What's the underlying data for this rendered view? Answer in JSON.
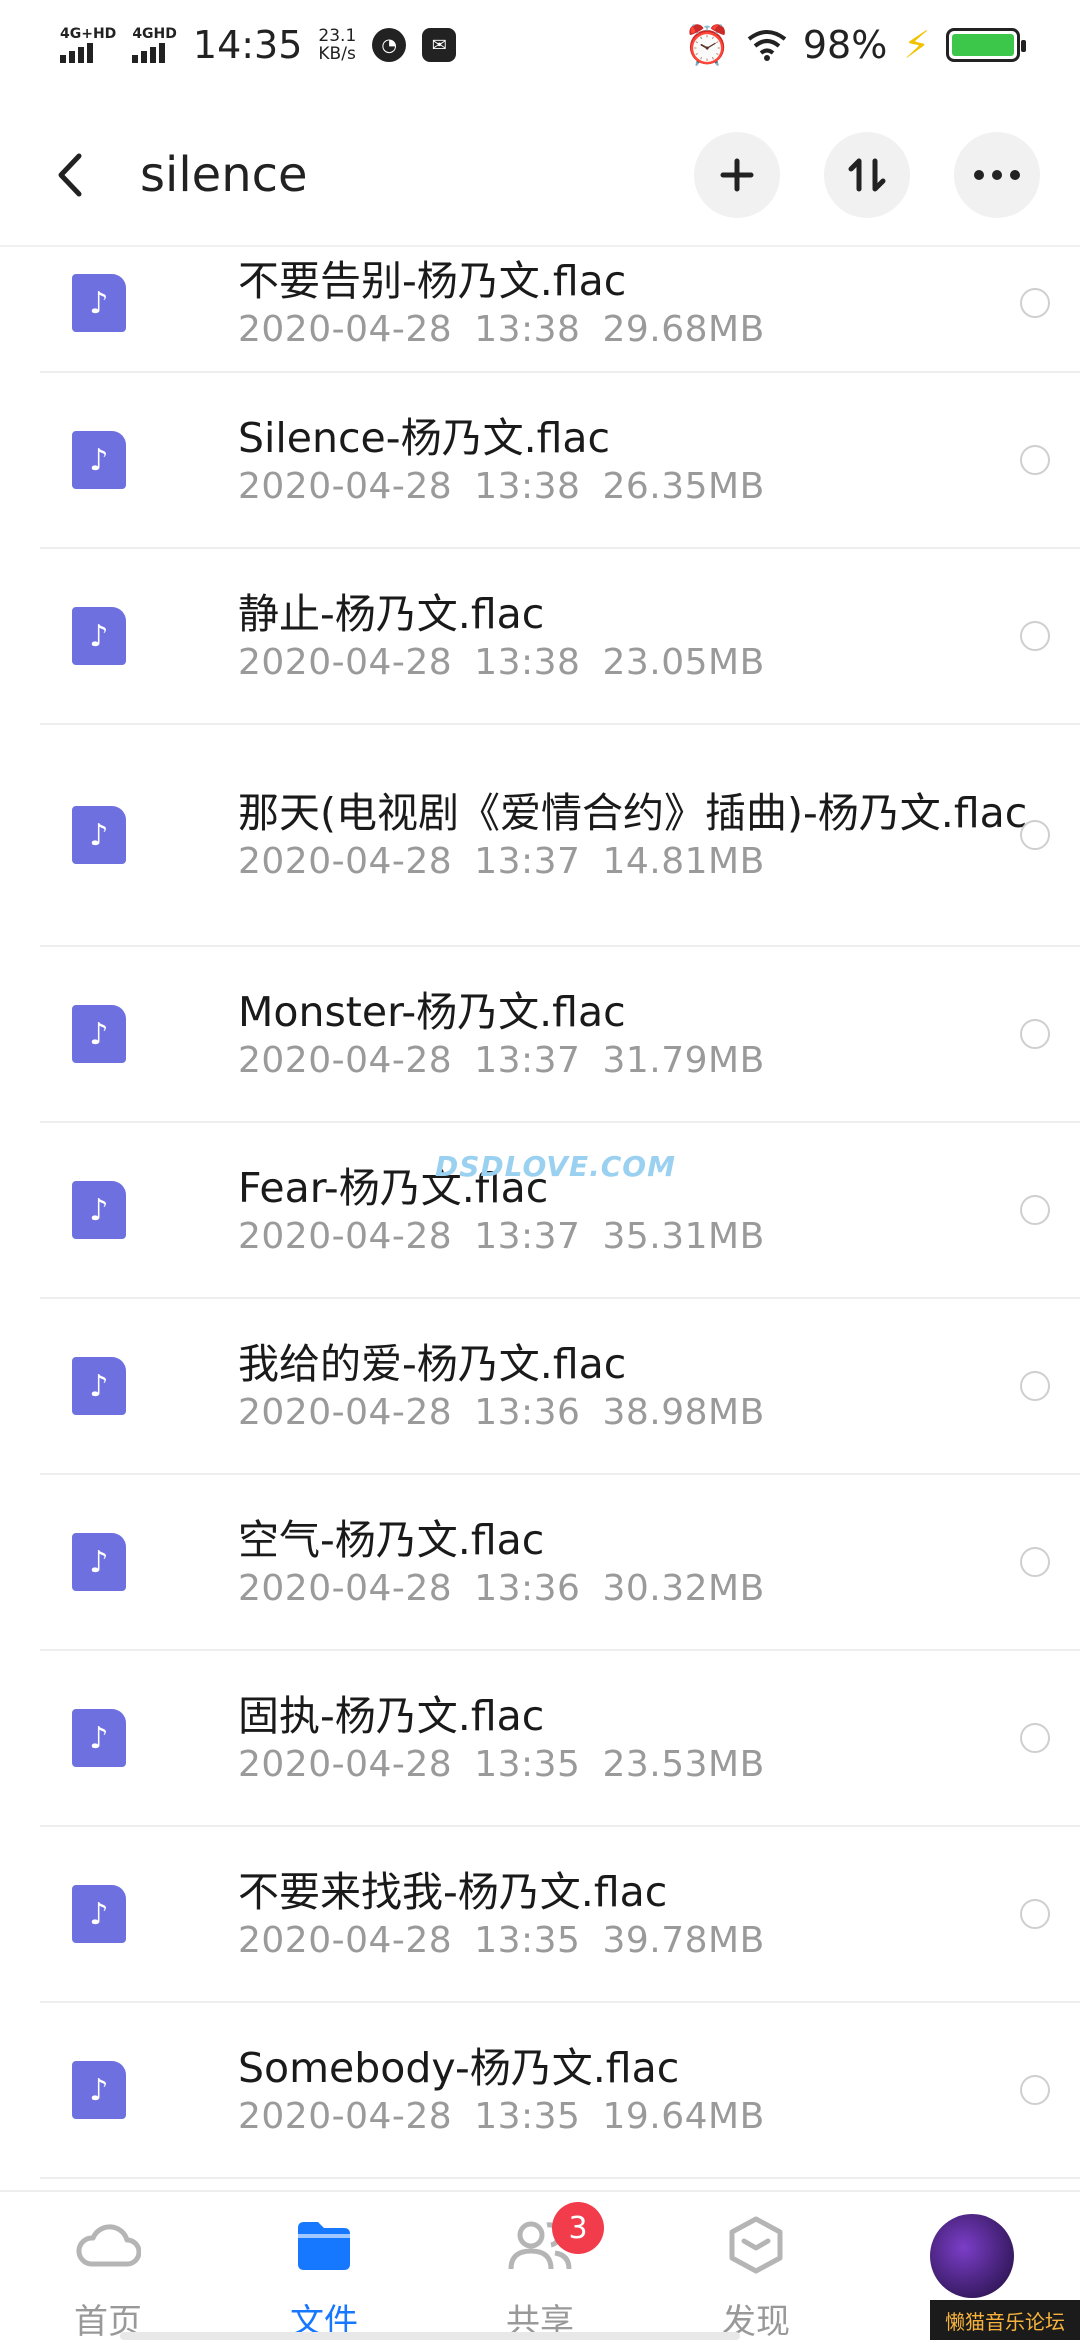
{
  "status_bar": {
    "net1": "4G+HD",
    "net2": "4GHD",
    "time": "14:35",
    "speed_value": "23.1",
    "speed_unit": "KB/s",
    "battery": "98%"
  },
  "header": {
    "title": "silence"
  },
  "files": [
    {
      "name": "不要告别-杨乃文.flac",
      "date": "2020-04-28",
      "time": "13:38",
      "size": "29.68MB"
    },
    {
      "name": "Silence-杨乃文.flac",
      "date": "2020-04-28",
      "time": "13:38",
      "size": "26.35MB"
    },
    {
      "name": "静止-杨乃文.flac",
      "date": "2020-04-28",
      "time": "13:38",
      "size": "23.05MB"
    },
    {
      "name": "那天(电视剧《爱情合约》插曲)-杨乃文.flac",
      "date": "2020-04-28",
      "time": "13:37",
      "size": "14.81MB"
    },
    {
      "name": "Monster-杨乃文.flac",
      "date": "2020-04-28",
      "time": "13:37",
      "size": "31.79MB"
    },
    {
      "name": "Fear-杨乃文.flac",
      "date": "2020-04-28",
      "time": "13:37",
      "size": "35.31MB"
    },
    {
      "name": "我给的爱-杨乃文.flac",
      "date": "2020-04-28",
      "time": "13:36",
      "size": "38.98MB"
    },
    {
      "name": "空气-杨乃文.flac",
      "date": "2020-04-28",
      "time": "13:36",
      "size": "30.32MB"
    },
    {
      "name": "固执-杨乃文.flac",
      "date": "2020-04-28",
      "time": "13:35",
      "size": "23.53MB"
    },
    {
      "name": "不要来找我-杨乃文.flac",
      "date": "2020-04-28",
      "time": "13:35",
      "size": "39.78MB"
    },
    {
      "name": "Somebody-杨乃文.flac",
      "date": "2020-04-28",
      "time": "13:35",
      "size": "19.64MB"
    }
  ],
  "watermark": "DSDLOVE.COM",
  "bottom_nav": {
    "home": "首页",
    "files": "文件",
    "share": "共享",
    "share_badge": "3",
    "discover": "发现"
  },
  "corner_text": "懒猫音乐论坛",
  "colors": {
    "accent": "#1677ff",
    "file_icon": "#6f70e0",
    "badge": "#f23c4b"
  }
}
